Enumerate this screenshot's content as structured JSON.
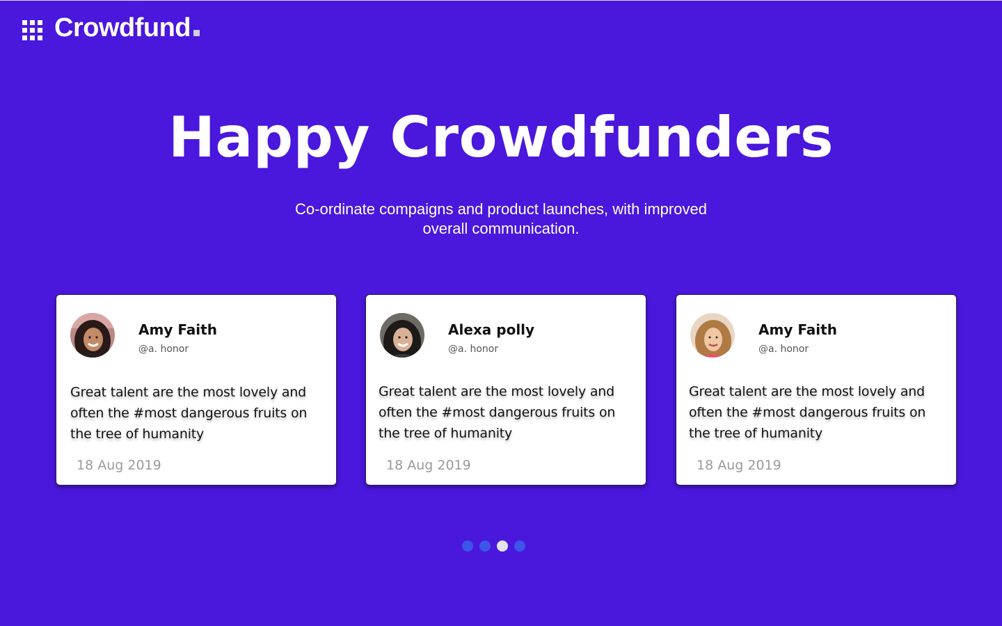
{
  "brand": {
    "name": "Crowdfund",
    "icon": "grid-icon"
  },
  "hero": {
    "title": "Happy Crowdfunders",
    "subtitle_line1": "Co-ordinate compaigns and product launches, with improved",
    "subtitle_line2": "overall communication."
  },
  "testimonials": [
    {
      "name": "Amy Faith",
      "handle": "@a. honor",
      "text_line1": "Great talent are the most lovely and",
      "text_line2": "often the #most dangerous fruits on",
      "text_line3": "the tree of humanity",
      "date": "18 Aug 2019"
    },
    {
      "name": "Alexa polly",
      "handle": "@a. honor",
      "text_line1": "Great talent are the most lovely and",
      "text_line2": "often the #most dangerous fruits on",
      "text_line3": "the tree of humanity",
      "date": "18 Aug 2019"
    },
    {
      "name": "Amy Faith",
      "handle": "@a. honor",
      "text_line1": "Great talent are the most lovely and",
      "text_line2": "often the #most dangerous fruits on",
      "text_line3": "the tree of humanity",
      "date": "18 Aug 2019"
    }
  ],
  "pagination": {
    "count": 4,
    "active_index": 2
  },
  "colors": {
    "background": "#4A17DC",
    "dot": "#3C56E8",
    "dot_active": "#E2E2EC",
    "card": "#FFFFFF",
    "date_text": "#9A9A9A"
  }
}
